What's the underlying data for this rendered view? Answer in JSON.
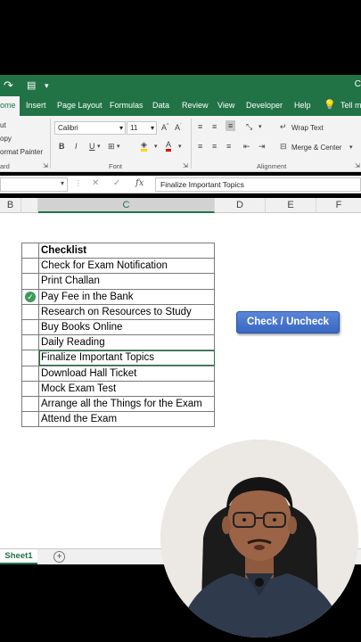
{
  "titlebar": {
    "title_fragment": "C"
  },
  "tabs": [
    {
      "label": "ome",
      "active": true
    },
    {
      "label": "Insert"
    },
    {
      "label": "Page Layout"
    },
    {
      "label": "Formulas"
    },
    {
      "label": "Data"
    },
    {
      "label": "Review"
    },
    {
      "label": "View"
    },
    {
      "label": "Developer"
    },
    {
      "label": "Help"
    },
    {
      "label": "Tell m"
    }
  ],
  "ribbon": {
    "clipboard": {
      "cut": "ut",
      "copy": "opy",
      "painter": "ormat Painter",
      "label": "ard"
    },
    "font": {
      "name": "Calibri",
      "size": "11",
      "bold": "B",
      "italic": "I",
      "underline": "U",
      "label": "Font"
    },
    "alignment": {
      "wrap": "Wrap Text",
      "merge": "Merge & Center",
      "label": "Alignment"
    }
  },
  "formula_bar": {
    "fx": "fx",
    "content": "Finalize Important Topics"
  },
  "columns": [
    "B",
    "C",
    "D",
    "E",
    "F"
  ],
  "checklist": {
    "header": "Checklist",
    "items": [
      {
        "text": "Check for Exam Notification",
        "checked": false
      },
      {
        "text": "Print Challan",
        "checked": false
      },
      {
        "text": "Pay Fee in the Bank",
        "checked": true
      },
      {
        "text": "Research on Resources to Study",
        "checked": false
      },
      {
        "text": "Buy Books Online",
        "checked": false
      },
      {
        "text": "Daily Reading",
        "checked": false
      },
      {
        "text": "Finalize Important Topics",
        "checked": false,
        "selected": true
      },
      {
        "text": "Download Hall Ticket",
        "checked": false
      },
      {
        "text": "Mock Exam Test",
        "checked": false
      },
      {
        "text": "Arrange all the Things for the Exam",
        "checked": false
      },
      {
        "text": "Attend the Exam",
        "checked": false
      }
    ]
  },
  "button": {
    "label": "Check / Uncheck"
  },
  "sheet_tabs": {
    "active": "Sheet1",
    "add": "+"
  },
  "colors": {
    "excel_green": "#217346",
    "button_blue": "#4472c4",
    "check_green": "#3d9a5a"
  }
}
